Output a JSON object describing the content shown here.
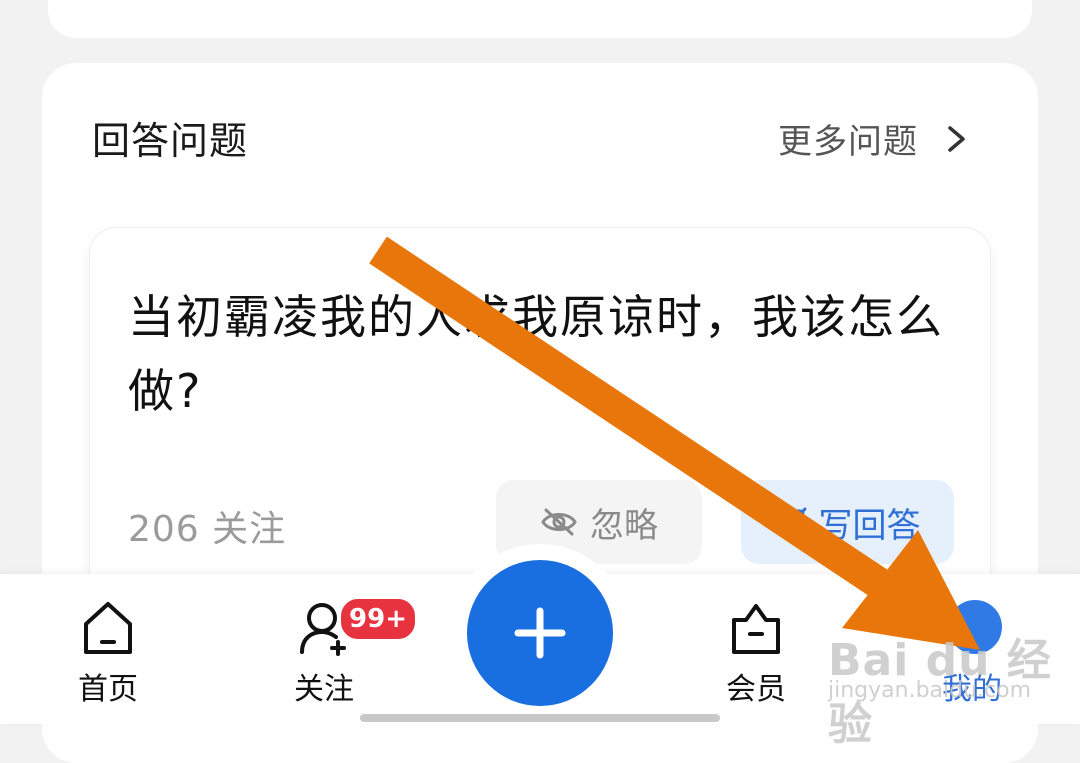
{
  "section": {
    "title": "回答问题",
    "more_label": "更多问题"
  },
  "question": {
    "text": "当初霸凌我的人求我原谅时，我该怎么做?",
    "follow_count": "206 关注",
    "ignore_label": "忽略",
    "write_label": "写回答"
  },
  "tabbar": {
    "home": "首页",
    "follow": "关注",
    "follow_badge": "99+",
    "vip": "会员",
    "mine": "我的"
  },
  "watermark": {
    "main": "Bai du 经验",
    "sub": "jingyan.baidu.com"
  },
  "colors": {
    "accent": "#1a6fe0",
    "badge": "#e7323f",
    "annotation_arrow": "#e8760a"
  }
}
